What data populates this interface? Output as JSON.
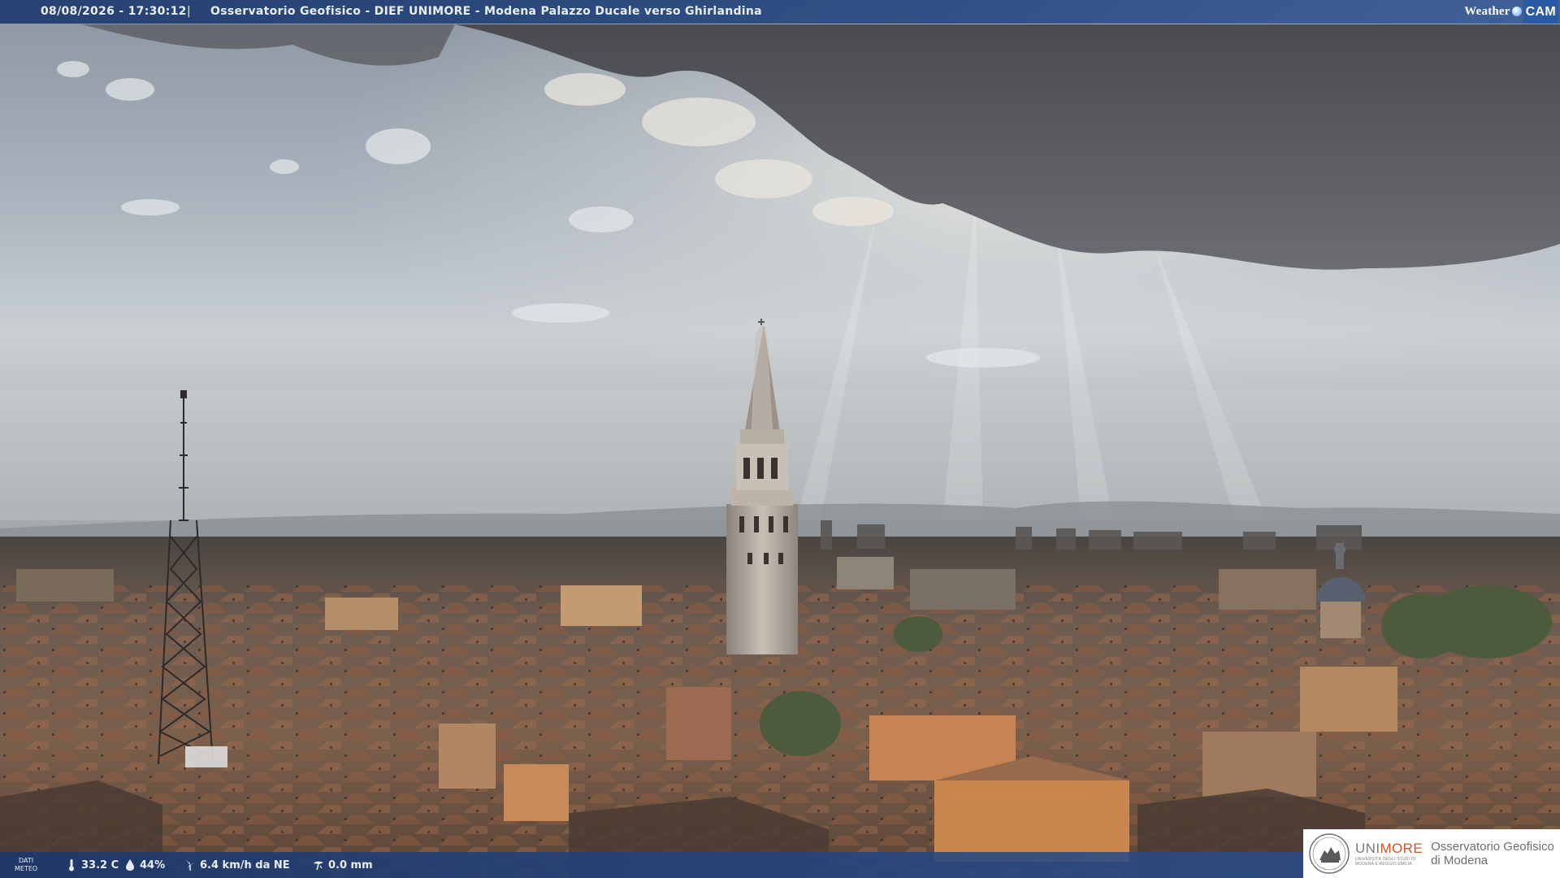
{
  "topbar": {
    "timestamp": "08/08/2026 - 17:30:12",
    "separator": "|",
    "location": "Osservatorio Geofisico - DIEF UNIMORE - Modena Palazzo Ducale verso Ghirlandina"
  },
  "brand": {
    "weather": "Weather",
    "cam": "CAM"
  },
  "weather": {
    "dati_label_1": "DATI",
    "dati_label_2": "METEO",
    "temperature": "33.2 C",
    "humidity": "44%",
    "wind": "6.4 km/h da NE",
    "rain": "0.0 mm"
  },
  "logo": {
    "unimore_a": "UNI",
    "unimore_b": "MORE",
    "university_line1": "UNIVERSITÀ DEGLI STUDI DI",
    "university_line2": "MODENA E REGGIO EMILIA",
    "observatory_line1": "Osservatorio Geofisico",
    "observatory_line2": "di Modena"
  },
  "colors": {
    "bar": "#244680",
    "unimore_accent": "#c8542c"
  }
}
